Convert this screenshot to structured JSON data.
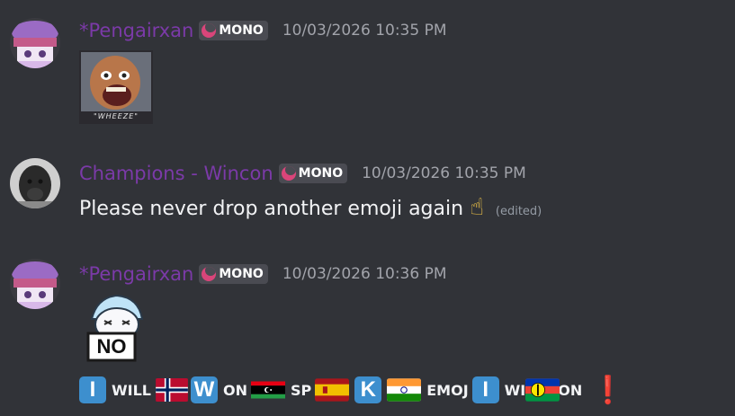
{
  "messages": [
    {
      "username": "*Pengairxan",
      "tag": "MONO",
      "timestamp": "10/03/2026 10:35 PM",
      "sticker_caption": "\"WHEEZE\""
    },
    {
      "username": "Champions - Wincon",
      "tag": "MONO",
      "timestamp": "10/03/2026 10:35 PM",
      "text": "Please never drop another emoji again",
      "emoji": "☝",
      "edited": "(edited)"
    },
    {
      "username": "*Pengairxan",
      "tag": "MONO",
      "timestamp": "10/03/2026 10:36 PM",
      "sticker_text": "NO",
      "emoji_line": {
        "tile_i": "I",
        "word_will": "WILL",
        "tile_w": "W",
        "word_on": "ON",
        "word_sp": "SP",
        "tile_k": "K",
        "word_emoj": "EMOJ",
        "word_wi": "WI",
        "word_on2": "ON",
        "exclamation": "❗"
      }
    }
  ],
  "colors": {
    "background": "#313338",
    "username": "#7b3aa8",
    "timestamp": "#a2a4ab",
    "tile": "#3d8fce"
  }
}
